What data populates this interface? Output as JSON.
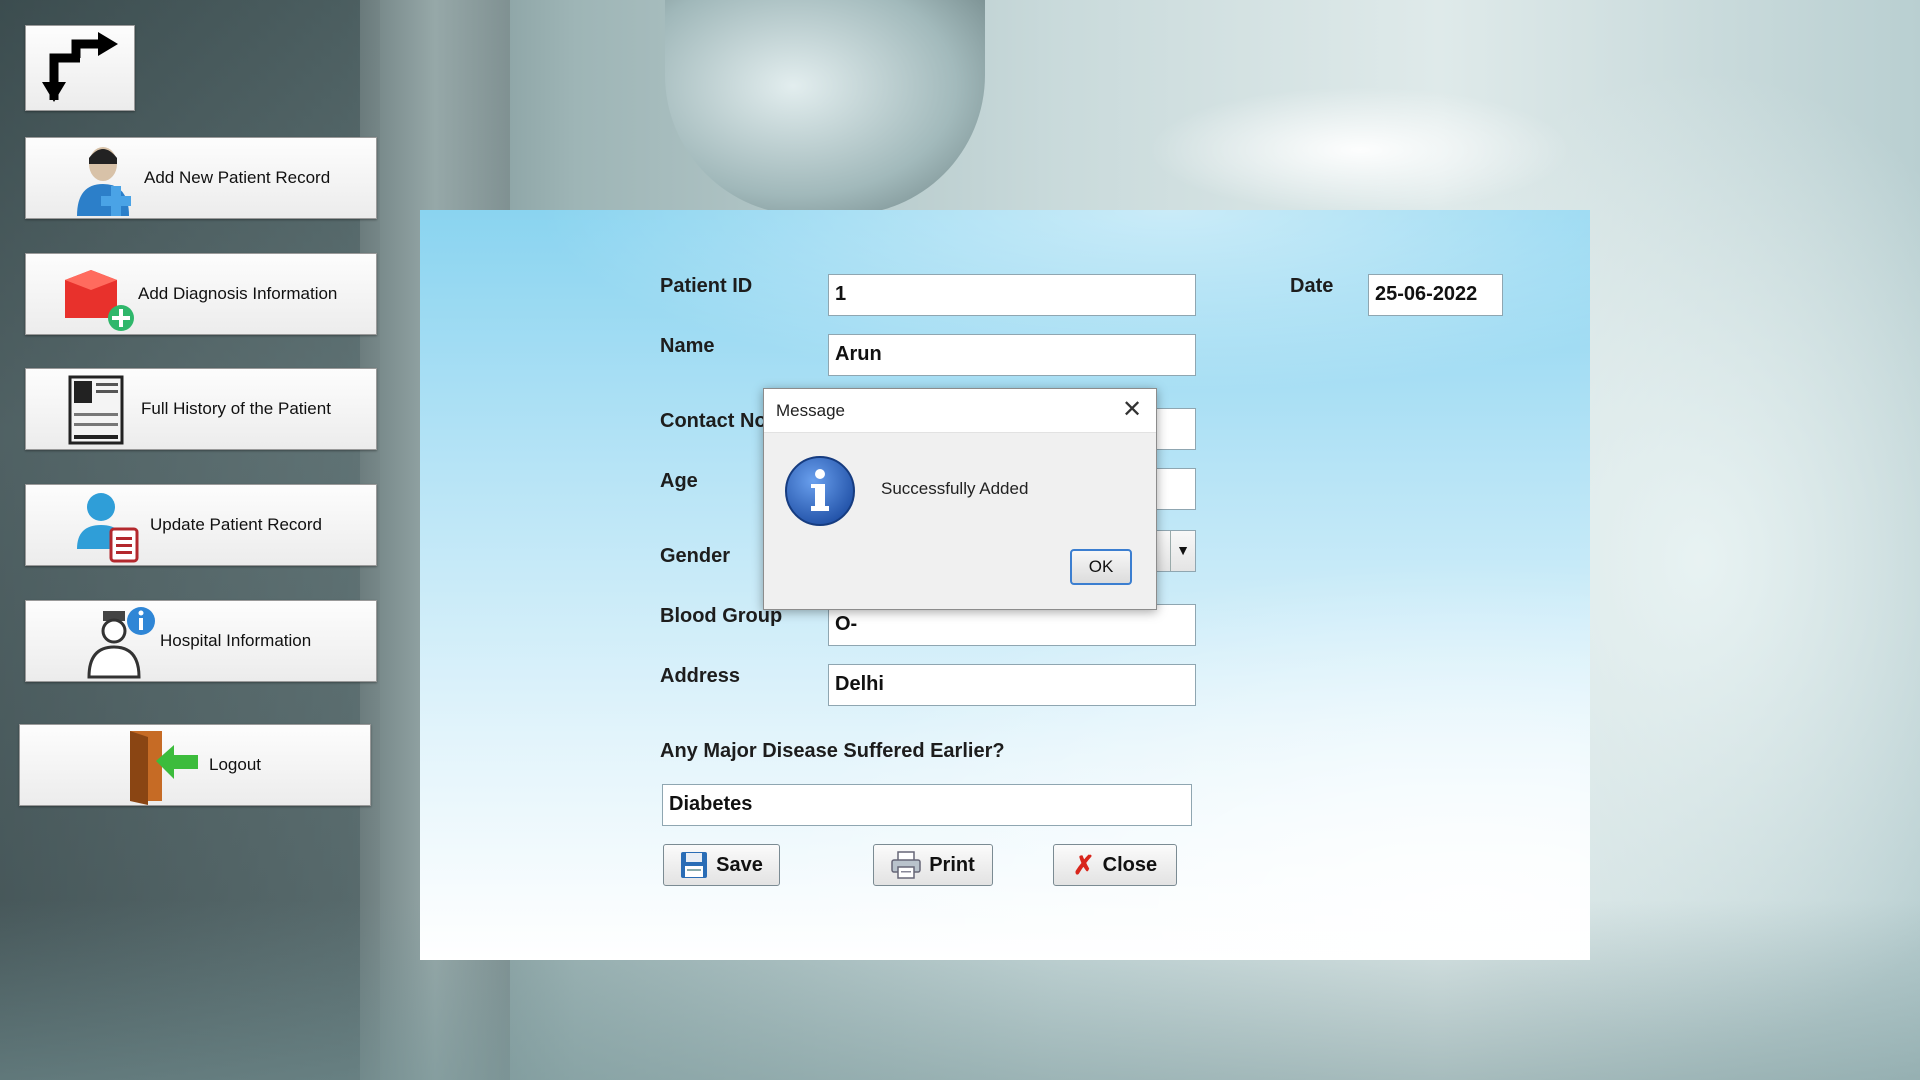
{
  "sidebar": {
    "back_icon": "redirect-arrows-icon",
    "items": [
      {
        "label": "Add New Patient Record",
        "icon": "add-patient-icon"
      },
      {
        "label": "Add Diagnosis Information",
        "icon": "add-diagnosis-icon"
      },
      {
        "label": "Full History of the Patient",
        "icon": "patient-file-icon"
      },
      {
        "label": "Update Patient Record",
        "icon": "update-record-icon"
      },
      {
        "label": "Hospital Information",
        "icon": "nurse-info-icon"
      },
      {
        "label": "Logout",
        "icon": "logout-door-icon"
      }
    ]
  },
  "form": {
    "patient_id_label": "Patient ID",
    "patient_id_value": "1",
    "date_label": "Date",
    "date_value": "25-06-2022",
    "name_label": "Name",
    "name_value": "Arun",
    "contact_label": "Contact No",
    "contact_value": "",
    "age_label": "Age",
    "age_value": "",
    "gender_label": "Gender",
    "gender_value": "",
    "blood_group_label": "Blood Group",
    "blood_group_value": "O-",
    "address_label": "Address",
    "address_value": "Delhi",
    "disease_label": "Any Major Disease Suffered Earlier?",
    "disease_value": "Diabetes"
  },
  "actions": {
    "save_label": "Save",
    "print_label": "Print",
    "close_label": "Close"
  },
  "dialog": {
    "title": "Message",
    "message": "Successfully Added",
    "ok_label": "OK",
    "close_glyph": "✕",
    "icon": "info-icon"
  },
  "colors": {
    "dialog_ok_border": "#3b7ed0",
    "info_icon": "#2a5fb8",
    "close_x": "#d8261c"
  }
}
